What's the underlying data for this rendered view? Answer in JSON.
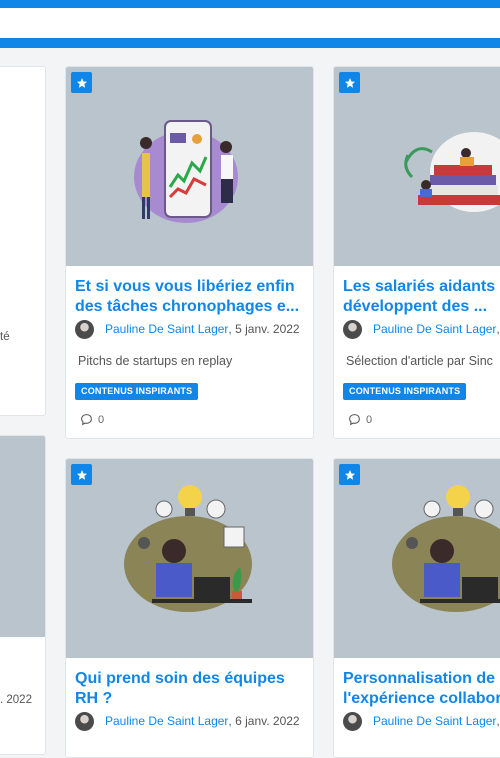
{
  "cards": [
    {
      "title": "Et si vous vous libériez enfin des tâches chronophages e...",
      "author": "Pauline De Saint Lager",
      "date": ", 5 janv. 2022",
      "description": "Pitchs de startups en replay",
      "tag": "CONTENUS INSPIRANTS",
      "comments": "0",
      "illustration": "phone-analytics-illustration"
    },
    {
      "title": "Les salariés aidants développent des ...",
      "author": "Pauline De Saint Lager",
      "date": ",",
      "description": "Sélection d'article par Sinc",
      "tag": "CONTENUS INSPIRANTS",
      "comments": "0",
      "illustration": "books-illustration"
    },
    {
      "title": "Qui prend soin des équipes RH ?",
      "author": "Pauline De Saint Lager",
      "date": ", 6 janv. 2022",
      "illustration": "thinking-man-illustration"
    },
    {
      "title": "Personnalisation de l'expérience collabor",
      "author": "Pauline De Saint Lager",
      "date": ",",
      "illustration": "thinking-man-illustration"
    }
  ],
  "left_fragments": {
    "top_text": "té",
    "bottom_text": ". 2022"
  },
  "colors": {
    "accent": "#1087e8",
    "thumb_bg": "#b9c4cc"
  }
}
